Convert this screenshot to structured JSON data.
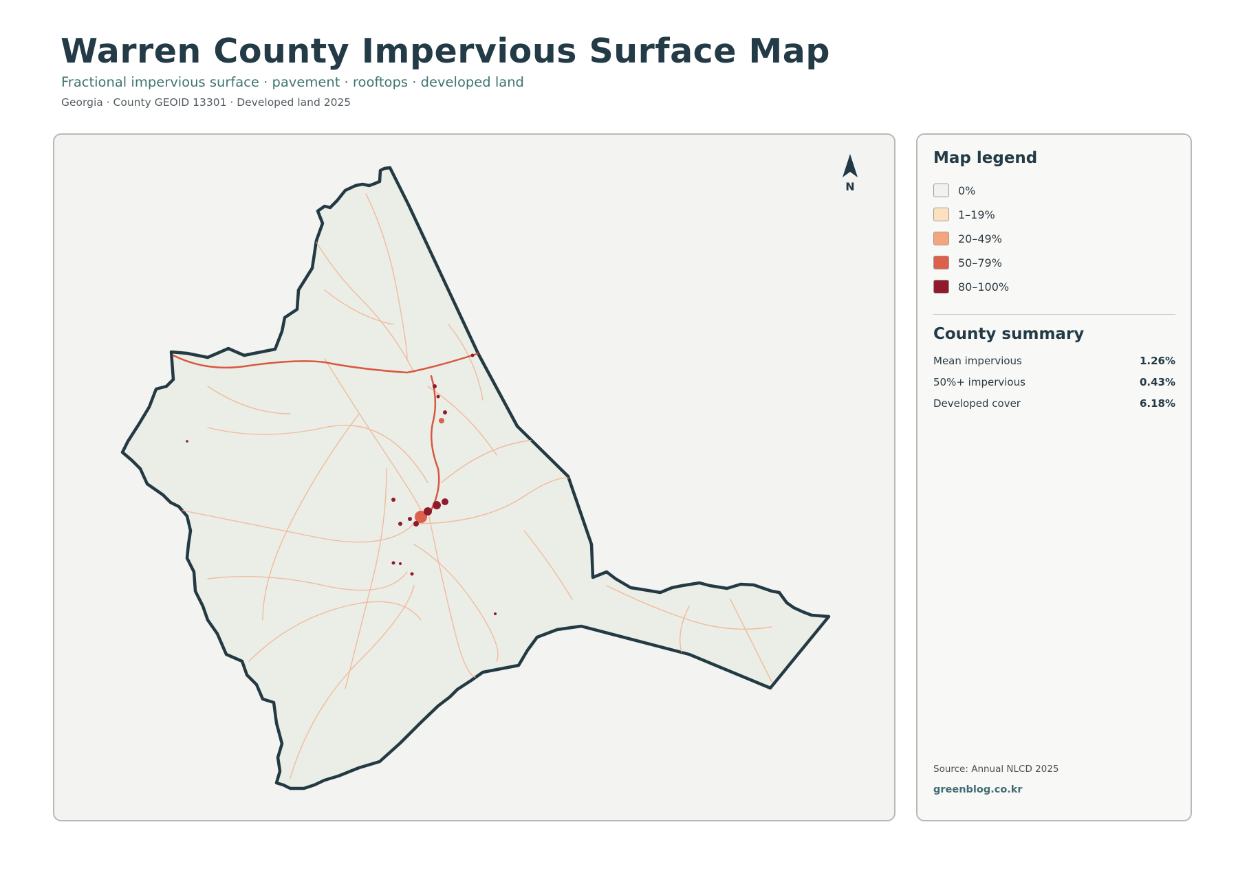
{
  "header": {
    "title": "Warren County Impervious Surface Map",
    "subtitle": "Fractional impervious surface · pavement · rooftops · developed land",
    "meta": "Georgia · County GEOID 13301 · Developed land 2025"
  },
  "map": {
    "north_label": "N",
    "county_fill": "#ebede7",
    "boundary_color": "#233a43",
    "road_color_light": "#f2b38f",
    "road_color_major": "#d9573f",
    "urban_color": "#8e1a2c"
  },
  "legend": {
    "title": "Map legend",
    "items": [
      {
        "label": "0%",
        "color": "#f1f1ef"
      },
      {
        "label": "1–19%",
        "color": "#fde0c0"
      },
      {
        "label": "20–49%",
        "color": "#f4a57d"
      },
      {
        "label": "50–79%",
        "color": "#dc604c"
      },
      {
        "label": "80–100%",
        "color": "#8e1a2c"
      }
    ]
  },
  "summary": {
    "title": "County summary",
    "rows": [
      {
        "label": "Mean impervious",
        "value": "1.26%"
      },
      {
        "label": "50%+ impervious",
        "value": "0.43%"
      },
      {
        "label": "Developed cover",
        "value": "6.18%"
      }
    ]
  },
  "footer": {
    "source": "Source: Annual NLCD 2025",
    "site": "greenblog.co.kr"
  }
}
